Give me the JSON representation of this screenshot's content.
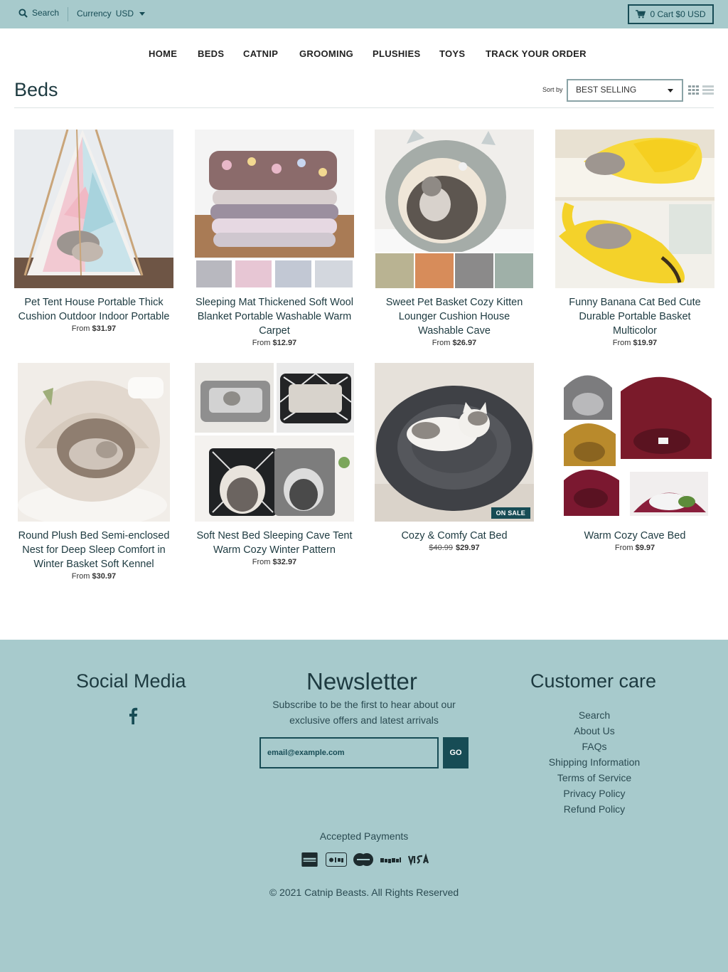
{
  "topbar": {
    "search_label": "Search",
    "currency_label": "Currency",
    "currency_value": "USD",
    "cart_label": "0 Cart $0 USD"
  },
  "nav": {
    "items": [
      {
        "label": "HOME"
      },
      {
        "label": "BEDS"
      },
      {
        "label": "CATNIP"
      },
      {
        "label": "GROOMING"
      },
      {
        "label": "PLUSHIES"
      },
      {
        "label": "TOYS"
      },
      {
        "label": "TRACK YOUR ORDER"
      }
    ]
  },
  "collection": {
    "title": "Beds",
    "sort_label": "Sort by",
    "sort_value": "BEST SELLING"
  },
  "products": [
    {
      "name": "Pet Tent House Portable Thick Cushion Outdoor Indoor Portable",
      "price_prefix": "From",
      "price": "$31.97",
      "old_price": "",
      "badge": ""
    },
    {
      "name": "Sleeping Mat Thickened Soft Wool Blanket Portable Washable Warm Carpet",
      "price_prefix": "From",
      "price": "$12.97",
      "old_price": "",
      "badge": ""
    },
    {
      "name": "Sweet Pet Basket Cozy Kitten Lounger Cushion House Washable Cave",
      "price_prefix": "From",
      "price": "$26.97",
      "old_price": "",
      "badge": ""
    },
    {
      "name": "Funny Banana Cat Bed Cute Durable Portable Basket Multicolor",
      "price_prefix": "From",
      "price": "$19.97",
      "old_price": "",
      "badge": ""
    },
    {
      "name": "Round Plush Bed Semi-enclosed Nest for Deep Sleep Comfort in Winter Basket Soft Kennel",
      "price_prefix": "From",
      "price": "$30.97",
      "old_price": "",
      "badge": ""
    },
    {
      "name": "Soft Nest Bed Sleeping Cave Tent Warm Cozy Winter Pattern",
      "price_prefix": "From",
      "price": "$32.97",
      "old_price": "",
      "badge": ""
    },
    {
      "name": "Cozy & Comfy Cat Bed",
      "price_prefix": "",
      "price": "$29.97",
      "old_price": "$40.99",
      "badge": "ON SALE"
    },
    {
      "name": "Warm Cozy Cave Bed",
      "price_prefix": "From",
      "price": "$9.97",
      "old_price": "",
      "badge": ""
    }
  ],
  "footer": {
    "social_heading": "Social Media",
    "newsletter_heading": "Newsletter",
    "newsletter_text": "Subscribe to be the first to hear about our exclusive offers and latest arrivals",
    "email_value": "email@example.com",
    "go_label": "GO",
    "care_heading": "Customer care",
    "care_links": [
      {
        "label": "Search"
      },
      {
        "label": "About Us"
      },
      {
        "label": "FAQs"
      },
      {
        "label": "Shipping Information"
      },
      {
        "label": "Terms of Service"
      },
      {
        "label": "Privacy Policy"
      },
      {
        "label": "Refund Policy"
      }
    ],
    "payments_label": "Accepted Payments",
    "payment_methods": [
      "american-express-icon",
      "apple-pay-icon",
      "mastercard-icon",
      "paypal-icon",
      "visa-icon"
    ],
    "copyright": "© 2021 Catnip Beasts. All Rights Reserved"
  },
  "colors": {
    "band": "#a7cacc",
    "accent": "#174c55"
  }
}
